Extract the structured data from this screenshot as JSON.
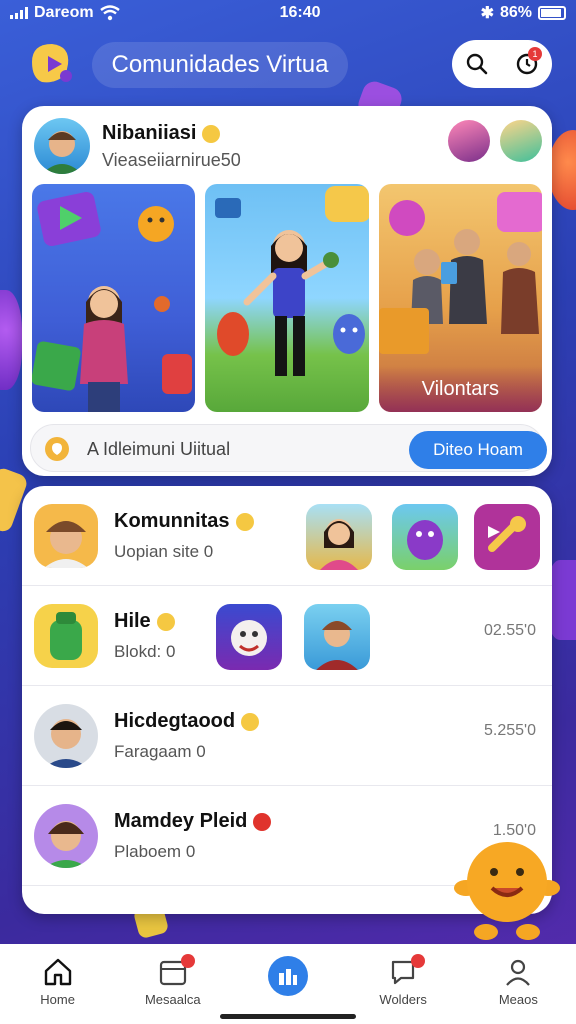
{
  "status_bar": {
    "carrier": "Dareom",
    "time": "16:40",
    "battery": "86%"
  },
  "header": {
    "title": "Comunidades Virtua"
  },
  "featured": {
    "name": "Nibaniiasi",
    "subtitle": "Vieaseiiarnirue50",
    "tiles": [
      {
        "label": ""
      },
      {
        "label": ""
      },
      {
        "label": "Vilontars"
      }
    ],
    "search_text": "A Idleimuni Uiitual",
    "join_label": "Diteo Hoam"
  },
  "list": [
    {
      "name": "Komunnitas",
      "sub": "Uopian site 0",
      "value": ""
    },
    {
      "name": "Hile",
      "sub": "Blokd: 0",
      "value": "02.55'0"
    },
    {
      "name": "Hicdegtaood",
      "sub": "Faragaam 0",
      "value": "5.255'0"
    },
    {
      "name": "Mamdey Pleid",
      "sub": "Plaboem 0",
      "value": "1.50'0"
    }
  ],
  "nav": [
    {
      "label": "Home"
    },
    {
      "label": "Mesaalca"
    },
    {
      "label": ""
    },
    {
      "label": "Wolders"
    },
    {
      "label": "Meaos"
    }
  ],
  "colors": {
    "accent": "#2f7fe8",
    "badge": "#e53939",
    "background": "#3a5fd8"
  }
}
